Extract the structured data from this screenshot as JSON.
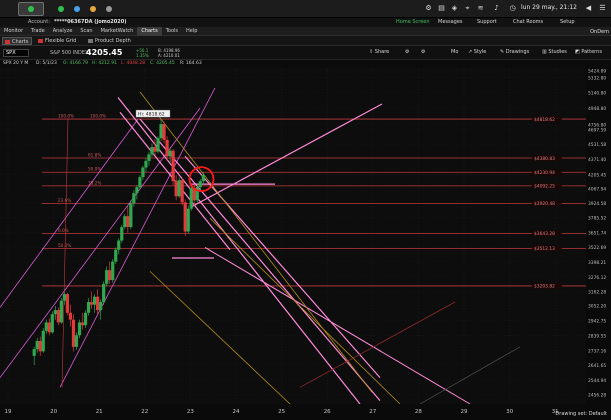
{
  "os": {
    "date_time": "lun 29 may., 21:12"
  },
  "header": {
    "account_label": "Account:",
    "account_value": "*****06367DA (jomo2020)",
    "home_screen": "Home Screen",
    "messages": "Messages",
    "support": "Support",
    "chat_rooms": "Chat Rooms",
    "setup": "Setup"
  },
  "main_tabs": [
    "Monitor",
    "Trade",
    "Analyze",
    "Scan",
    "MarketWatch",
    "Charts",
    "Tools",
    "Help"
  ],
  "active_main_tab": "Charts",
  "ondemand": "OnDem",
  "sub_tabs": {
    "charts": "Charts",
    "flexible_grid": "Flexible Grid",
    "product_depth": "Product Depth"
  },
  "toolbar": {
    "symbol": "SPX",
    "description": "S&P 500 INDEX",
    "last": "4205.45",
    "change": "+56.1",
    "change_pct": "1.35%",
    "bid": "B: 4198.96",
    "ask": "A: 4210.01",
    "share": "Share",
    "style": "Style",
    "drawings": "Drawings",
    "studies": "Studies",
    "patterns": "Patterns",
    "period": "Mo"
  },
  "quote_line": {
    "symbol": "SPX 20 Y M",
    "date": "D: 5/1/23",
    "open": "O: 4166.79",
    "high": "H: 4212.91",
    "low": "L: 4048.28",
    "close": "C: 4205.45",
    "range": "R: 164.63"
  },
  "colors": {
    "up": "#2fa84f",
    "down": "#e33b3b",
    "magenta": "#d85ad8",
    "pink": "#ff8ad8",
    "gold": "#b58e1e",
    "fib_red": "#c23a3a",
    "price_tag": "#8b2323",
    "circle": "#ff1a1a"
  },
  "chart_data": {
    "type": "candlestick",
    "title": "",
    "ylim": [
      2400,
      5460
    ],
    "y_ticks": [
      5424.89,
      5332.8,
      5140.8,
      4948.8,
      4756.8,
      4697.59,
      4531.58,
      4371.4,
      4205.45,
      4067.94,
      3924.58,
      3785.52,
      3651.74,
      3522.69,
      3398.21,
      3276.12,
      3162.28,
      3052.2,
      2942.75,
      2839.55,
      2737.16,
      2641.65,
      2544.94,
      2456.28
    ],
    "x_ticks": [
      "19",
      "20",
      "21",
      "22",
      "23",
      "24",
      "25",
      "26",
      "27",
      "28",
      "29",
      "30",
      "31"
    ],
    "fib_levels": [
      {
        "label": "100.0%",
        "value": 4818.62,
        "tag": "$4818.62"
      },
      {
        "label": "61.8%",
        "value": 4380.83,
        "tag": "$4380.83"
      },
      {
        "label": "50.0%",
        "value": 4230.94,
        "tag": "$4230.94"
      },
      {
        "label": "38.2%",
        "value": 4092.25,
        "tag": "$4092.25"
      },
      {
        "label": "23.6%",
        "value": 3920.48,
        "tag": "$3920.48"
      },
      {
        "label": "0.0%",
        "value": 3643.28,
        "tag": "$3643.28"
      },
      {
        "label": "50.0%",
        "value": 3512.13,
        "tag": "$3512.13"
      },
      {
        "label": "0.0%",
        "value": 3203.82,
        "tag": "$3203.82"
      }
    ],
    "fib_left_labels": [
      "100.0%",
      "100.0%",
      "61.8%",
      "50.0%",
      "38.2%",
      "23.6%",
      "0.0%",
      "50.0%"
    ],
    "high_tooltip": "Hi: 4818.62",
    "current_price_tag": "4205.45",
    "candles": [
      [
        4.0,
        2700,
        2760,
        2640,
        2745
      ],
      [
        4.4,
        2745,
        2820,
        2720,
        2800
      ],
      [
        4.8,
        2800,
        2830,
        2700,
        2730
      ],
      [
        5.2,
        2730,
        2890,
        2720,
        2870
      ],
      [
        5.6,
        2870,
        2950,
        2850,
        2930
      ],
      [
        6.0,
        2930,
        2960,
        2840,
        2860
      ],
      [
        6.4,
        2860,
        3010,
        2850,
        2990
      ],
      [
        6.8,
        2990,
        3050,
        2950,
        3020
      ],
      [
        7.2,
        3020,
        3040,
        2910,
        2930
      ],
      [
        7.6,
        2930,
        3110,
        2920,
        3090
      ],
      [
        8.0,
        3090,
        3160,
        3060,
        3140
      ],
      [
        8.4,
        3140,
        3150,
        2980,
        3000
      ],
      [
        8.8,
        3000,
        3060,
        2900,
        2950
      ],
      [
        9.2,
        2950,
        2990,
        2730,
        2760
      ],
      [
        9.6,
        2760,
        2860,
        2740,
        2840
      ],
      [
        10.0,
        2840,
        2950,
        2820,
        2930
      ],
      [
        10.4,
        2930,
        3000,
        2880,
        2910
      ],
      [
        10.8,
        2910,
        3020,
        2890,
        3000
      ],
      [
        11.2,
        3000,
        3110,
        2980,
        3080
      ],
      [
        11.6,
        3080,
        3160,
        3030,
        3060
      ],
      [
        12.0,
        3060,
        3140,
        3000,
        3120
      ],
      [
        12.4,
        3120,
        3180,
        2990,
        3020
      ],
      [
        12.8,
        3020,
        3100,
        2950,
        3080
      ],
      [
        13.2,
        3080,
        3240,
        3060,
        3220
      ],
      [
        13.6,
        3220,
        3360,
        3200,
        3330
      ],
      [
        14.0,
        3330,
        3400,
        3220,
        3250
      ],
      [
        14.4,
        3250,
        3420,
        3230,
        3400
      ],
      [
        14.8,
        3400,
        3520,
        3380,
        3500
      ],
      [
        15.2,
        3500,
        3600,
        3460,
        3580
      ],
      [
        15.6,
        3580,
        3720,
        3560,
        3700
      ],
      [
        16.0,
        3700,
        3820,
        3680,
        3800
      ],
      [
        16.4,
        3800,
        3900,
        3650,
        3700
      ],
      [
        16.8,
        3700,
        3950,
        3680,
        3920
      ],
      [
        17.2,
        3920,
        4050,
        3890,
        4020
      ],
      [
        17.6,
        4020,
        4100,
        3960,
        4080
      ],
      [
        18.0,
        4080,
        4200,
        4060,
        4180
      ],
      [
        18.4,
        4180,
        4300,
        4150,
        4280
      ],
      [
        18.8,
        4280,
        4380,
        4230,
        4350
      ],
      [
        19.2,
        4350,
        4450,
        4300,
        4420
      ],
      [
        19.6,
        4420,
        4540,
        4390,
        4500
      ],
      [
        20.0,
        4500,
        4590,
        4410,
        4450
      ],
      [
        20.4,
        4450,
        4620,
        4430,
        4600
      ],
      [
        20.8,
        4600,
        4818,
        4570,
        4760
      ],
      [
        21.2,
        4760,
        4790,
        4540,
        4580
      ],
      [
        21.6,
        4580,
        4620,
        4350,
        4400
      ],
      [
        22.0,
        4400,
        4500,
        4330,
        4460
      ],
      [
        22.4,
        4460,
        4480,
        4100,
        4140
      ],
      [
        22.8,
        4140,
        4200,
        3950,
        3990
      ],
      [
        23.2,
        3990,
        4180,
        3970,
        4150
      ],
      [
        23.6,
        4150,
        4170,
        3900,
        3930
      ],
      [
        24.0,
        3930,
        3960,
        3620,
        3660
      ],
      [
        24.4,
        3660,
        3900,
        3640,
        3870
      ],
      [
        24.8,
        3870,
        4090,
        3850,
        4070
      ],
      [
        25.2,
        4070,
        4110,
        3900,
        3950
      ],
      [
        25.6,
        3950,
        4100,
        3920,
        4080
      ],
      [
        26.0,
        4080,
        4160,
        4050,
        4140
      ],
      [
        26.4,
        4140,
        4230,
        4110,
        4205
      ]
    ]
  }
}
